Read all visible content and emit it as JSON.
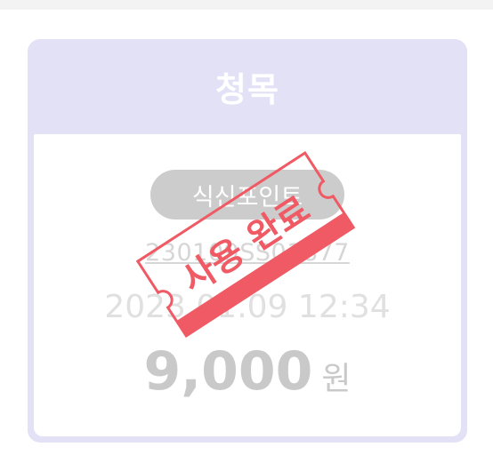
{
  "card": {
    "title": "청목",
    "category": "식신포인트",
    "code": "230109SS01877",
    "datetime": "2023.01.09 12:34",
    "price": "9,000",
    "currency": "원"
  },
  "stamp": {
    "text": "사용 완료",
    "color": "#ef5a64"
  },
  "colors": {
    "header": "#e3e1f5",
    "muted_text": "#d6d6d6",
    "pill": "#cccccc"
  }
}
